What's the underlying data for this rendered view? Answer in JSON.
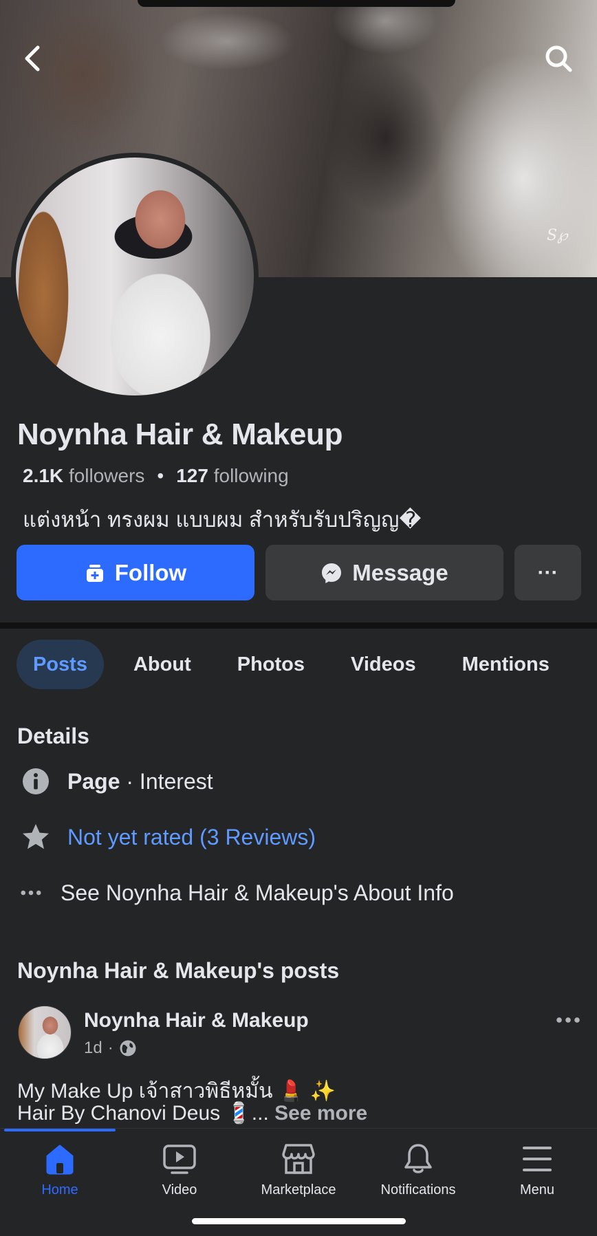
{
  "cover": {
    "watermark": "S℘"
  },
  "profile": {
    "name": "Noynha Hair & Makeup",
    "followers_count": "2.1K",
    "followers_label": "followers",
    "separator": "•",
    "following_count": "127",
    "following_label": "following",
    "bio": "แต่งหน้า ทรงผม แบบผม สำหรับรับปริญญ�"
  },
  "actions": {
    "follow": "Follow",
    "message": "Message",
    "more": "···"
  },
  "tabs": [
    {
      "label": "Posts",
      "active": true
    },
    {
      "label": "About"
    },
    {
      "label": "Photos"
    },
    {
      "label": "Videos"
    },
    {
      "label": "Mentions"
    }
  ],
  "details": {
    "title": "Details",
    "page_type_bold": "Page",
    "page_type_rest": " · Interest",
    "rating": "Not yet rated (3 Reviews)",
    "about_link": "See Noynha Hair & Makeup's About Info"
  },
  "posts": {
    "title": "Noynha Hair & Makeup's posts",
    "author": "Noynha Hair & Makeup",
    "time": "1d",
    "meta_dot": "·",
    "line1": "My Make Up เจ้าสาวพิธีหมั้น 💄 ✨",
    "line2": "Hair By Chanovi Deus 💈... ",
    "see_more": "See more"
  },
  "nav": {
    "home": "Home",
    "video": "Video",
    "marketplace": "Marketplace",
    "notifications": "Notifications",
    "menu": "Menu"
  },
  "colors": {
    "accent": "#2d6bff",
    "link": "#5f9aff",
    "background": "#242527"
  }
}
